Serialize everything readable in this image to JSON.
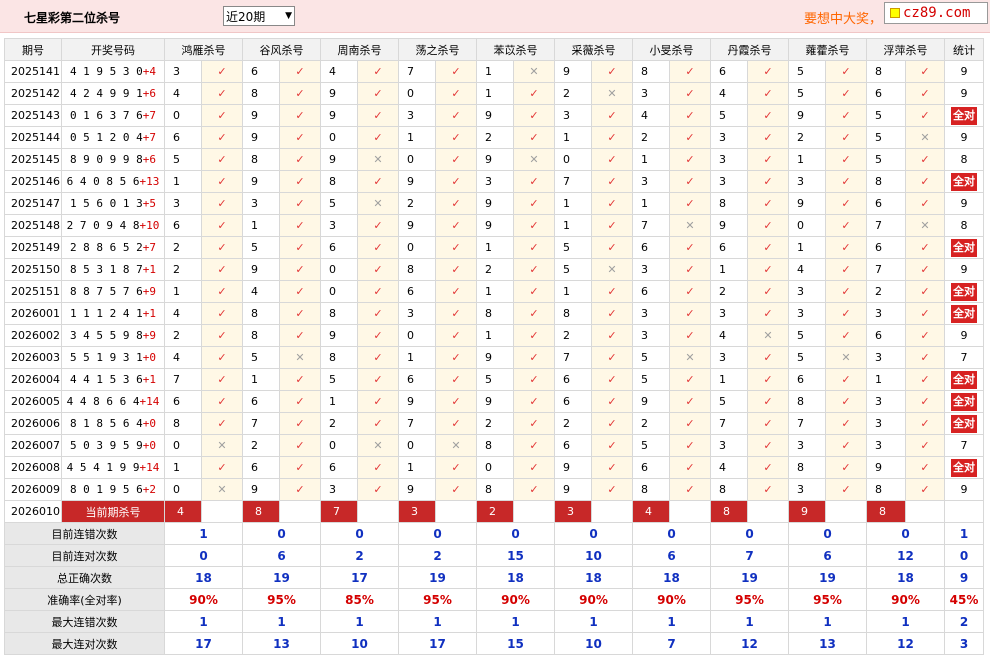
{
  "page": {
    "title": "七星彩第二位杀号",
    "period_select": "近20期",
    "promo": "要想中大奖，",
    "logo": "cz89.com"
  },
  "columns": {
    "issue": "期号",
    "draw": "开奖号码",
    "kills": [
      "鸿雁杀号",
      "谷风杀号",
      "周南杀号",
      "荡之杀号",
      "苯苡杀号",
      "采薇杀号",
      "小旻杀号",
      "丹霞杀号",
      "蕹藿杀号",
      "浮萍杀号"
    ],
    "total": "统计"
  },
  "rows": [
    {
      "issue": "2025141",
      "draw": "419530",
      "plus": "+4",
      "kills": [
        [
          3,
          1
        ],
        [
          6,
          1
        ],
        [
          4,
          1
        ],
        [
          7,
          1
        ],
        [
          1,
          0
        ],
        [
          9,
          1
        ],
        [
          8,
          1
        ],
        [
          6,
          1
        ],
        [
          5,
          1
        ],
        [
          8,
          1
        ]
      ],
      "total": "9"
    },
    {
      "issue": "2025142",
      "draw": "424991",
      "plus": "+6",
      "kills": [
        [
          4,
          1
        ],
        [
          8,
          1
        ],
        [
          9,
          1
        ],
        [
          0,
          1
        ],
        [
          1,
          1
        ],
        [
          2,
          0
        ],
        [
          3,
          1
        ],
        [
          4,
          1
        ],
        [
          5,
          1
        ],
        [
          6,
          1
        ]
      ],
      "total": "9"
    },
    {
      "issue": "2025143",
      "draw": "016376",
      "plus": "+7",
      "kills": [
        [
          0,
          1
        ],
        [
          9,
          1
        ],
        [
          9,
          1
        ],
        [
          3,
          1
        ],
        [
          9,
          1
        ],
        [
          3,
          1
        ],
        [
          4,
          1
        ],
        [
          5,
          1
        ],
        [
          9,
          1
        ],
        [
          5,
          1
        ]
      ],
      "total": "全对"
    },
    {
      "issue": "2025144",
      "draw": "051204",
      "plus": "+7",
      "kills": [
        [
          6,
          1
        ],
        [
          9,
          1
        ],
        [
          0,
          1
        ],
        [
          1,
          1
        ],
        [
          2,
          1
        ],
        [
          1,
          1
        ],
        [
          2,
          1
        ],
        [
          3,
          1
        ],
        [
          2,
          1
        ],
        [
          5,
          0
        ]
      ],
      "total": "9"
    },
    {
      "issue": "2025145",
      "draw": "890998",
      "plus": "+6",
      "kills": [
        [
          5,
          1
        ],
        [
          8,
          1
        ],
        [
          9,
          0
        ],
        [
          0,
          1
        ],
        [
          9,
          0
        ],
        [
          0,
          1
        ],
        [
          1,
          1
        ],
        [
          3,
          1
        ],
        [
          1,
          1
        ],
        [
          5,
          1
        ]
      ],
      "total": "8"
    },
    {
      "issue": "2025146",
      "draw": "640856",
      "plus": "+13",
      "kills": [
        [
          1,
          1
        ],
        [
          9,
          1
        ],
        [
          8,
          1
        ],
        [
          9,
          1
        ],
        [
          3,
          1
        ],
        [
          7,
          1
        ],
        [
          3,
          1
        ],
        [
          3,
          1
        ],
        [
          3,
          1
        ],
        [
          8,
          1
        ]
      ],
      "total": "全对"
    },
    {
      "issue": "2025147",
      "draw": "156013",
      "plus": "+5",
      "kills": [
        [
          3,
          1
        ],
        [
          3,
          1
        ],
        [
          5,
          0
        ],
        [
          2,
          1
        ],
        [
          9,
          1
        ],
        [
          1,
          1
        ],
        [
          1,
          1
        ],
        [
          8,
          1
        ],
        [
          9,
          1
        ],
        [
          6,
          1
        ]
      ],
      "total": "9"
    },
    {
      "issue": "2025148",
      "draw": "270948",
      "plus": "+10",
      "kills": [
        [
          6,
          1
        ],
        [
          1,
          1
        ],
        [
          3,
          1
        ],
        [
          9,
          1
        ],
        [
          9,
          1
        ],
        [
          1,
          1
        ],
        [
          7,
          0
        ],
        [
          9,
          1
        ],
        [
          0,
          1
        ],
        [
          7,
          0
        ]
      ],
      "total": "8"
    },
    {
      "issue": "2025149",
      "draw": "288652",
      "plus": "+7",
      "kills": [
        [
          2,
          1
        ],
        [
          5,
          1
        ],
        [
          6,
          1
        ],
        [
          0,
          1
        ],
        [
          1,
          1
        ],
        [
          5,
          1
        ],
        [
          6,
          1
        ],
        [
          6,
          1
        ],
        [
          1,
          1
        ],
        [
          6,
          1
        ]
      ],
      "total": "全对"
    },
    {
      "issue": "2025150",
      "draw": "853187",
      "plus": "+1",
      "kills": [
        [
          2,
          1
        ],
        [
          9,
          1
        ],
        [
          0,
          1
        ],
        [
          8,
          1
        ],
        [
          2,
          1
        ],
        [
          5,
          0
        ],
        [
          3,
          1
        ],
        [
          1,
          1
        ],
        [
          4,
          1
        ],
        [
          7,
          1
        ]
      ],
      "total": "9"
    },
    {
      "issue": "2025151",
      "draw": "887576",
      "plus": "+9",
      "kills": [
        [
          1,
          1
        ],
        [
          4,
          1
        ],
        [
          0,
          1
        ],
        [
          6,
          1
        ],
        [
          1,
          1
        ],
        [
          1,
          1
        ],
        [
          6,
          1
        ],
        [
          2,
          1
        ],
        [
          3,
          1
        ],
        [
          2,
          1
        ]
      ],
      "total": "全对"
    },
    {
      "issue": "2026001",
      "draw": "111241",
      "plus": "+1",
      "kills": [
        [
          4,
          1
        ],
        [
          8,
          1
        ],
        [
          8,
          1
        ],
        [
          3,
          1
        ],
        [
          8,
          1
        ],
        [
          8,
          1
        ],
        [
          3,
          1
        ],
        [
          3,
          1
        ],
        [
          3,
          1
        ],
        [
          3,
          1
        ]
      ],
      "total": "全对"
    },
    {
      "issue": "2026002",
      "draw": "345598",
      "plus": "+9",
      "kills": [
        [
          2,
          1
        ],
        [
          8,
          1
        ],
        [
          9,
          1
        ],
        [
          0,
          1
        ],
        [
          1,
          1
        ],
        [
          2,
          1
        ],
        [
          3,
          1
        ],
        [
          4,
          0
        ],
        [
          5,
          1
        ],
        [
          6,
          1
        ]
      ],
      "total": "9"
    },
    {
      "issue": "2026003",
      "draw": "551931",
      "plus": "+0",
      "kills": [
        [
          4,
          1
        ],
        [
          5,
          0
        ],
        [
          8,
          1
        ],
        [
          1,
          1
        ],
        [
          9,
          1
        ],
        [
          7,
          1
        ],
        [
          5,
          0
        ],
        [
          3,
          1
        ],
        [
          5,
          0
        ],
        [
          3,
          1
        ]
      ],
      "total": "7"
    },
    {
      "issue": "2026004",
      "draw": "441536",
      "plus": "+1",
      "kills": [
        [
          7,
          1
        ],
        [
          1,
          1
        ],
        [
          5,
          1
        ],
        [
          6,
          1
        ],
        [
          5,
          1
        ],
        [
          6,
          1
        ],
        [
          5,
          1
        ],
        [
          1,
          1
        ],
        [
          6,
          1
        ],
        [
          1,
          1
        ]
      ],
      "total": "全对"
    },
    {
      "issue": "2026005",
      "draw": "448664",
      "plus": "+14",
      "kills": [
        [
          6,
          1
        ],
        [
          6,
          1
        ],
        [
          1,
          1
        ],
        [
          9,
          1
        ],
        [
          9,
          1
        ],
        [
          6,
          1
        ],
        [
          9,
          1
        ],
        [
          5,
          1
        ],
        [
          8,
          1
        ],
        [
          3,
          1
        ]
      ],
      "total": "全对"
    },
    {
      "issue": "2026006",
      "draw": "818564",
      "plus": "+0",
      "kills": [
        [
          8,
          1
        ],
        [
          7,
          1
        ],
        [
          2,
          1
        ],
        [
          7,
          1
        ],
        [
          2,
          1
        ],
        [
          2,
          1
        ],
        [
          2,
          1
        ],
        [
          7,
          1
        ],
        [
          7,
          1
        ],
        [
          3,
          1
        ]
      ],
      "total": "全对"
    },
    {
      "issue": "2026007",
      "draw": "503959",
      "plus": "+0",
      "kills": [
        [
          0,
          0
        ],
        [
          2,
          1
        ],
        [
          0,
          0
        ],
        [
          0,
          0
        ],
        [
          8,
          1
        ],
        [
          6,
          1
        ],
        [
          5,
          1
        ],
        [
          3,
          1
        ],
        [
          3,
          1
        ],
        [
          3,
          1
        ]
      ],
      "total": "7"
    },
    {
      "issue": "2026008",
      "draw": "454199",
      "plus": "+14",
      "kills": [
        [
          1,
          1
        ],
        [
          6,
          1
        ],
        [
          6,
          1
        ],
        [
          1,
          1
        ],
        [
          0,
          1
        ],
        [
          9,
          1
        ],
        [
          6,
          1
        ],
        [
          4,
          1
        ],
        [
          8,
          1
        ],
        [
          9,
          1
        ]
      ],
      "total": "全对"
    },
    {
      "issue": "2026009",
      "draw": "801956",
      "plus": "+2",
      "kills": [
        [
          0,
          0
        ],
        [
          9,
          1
        ],
        [
          3,
          1
        ],
        [
          9,
          1
        ],
        [
          8,
          1
        ],
        [
          9,
          1
        ],
        [
          8,
          1
        ],
        [
          8,
          1
        ],
        [
          3,
          1
        ],
        [
          8,
          1
        ]
      ],
      "total": "9"
    }
  ],
  "current": {
    "issue": "2026010",
    "label": "当前期杀号",
    "kills": [
      "4",
      "8",
      "7",
      "3",
      "2",
      "3",
      "4",
      "8",
      "9",
      "8"
    ]
  },
  "stats": [
    {
      "label": "目前连错次数",
      "values": [
        "1",
        "0",
        "0",
        "0",
        "0",
        "0",
        "0",
        "0",
        "0",
        "0",
        "1"
      ]
    },
    {
      "label": "目前连对次数",
      "values": [
        "0",
        "6",
        "2",
        "2",
        "15",
        "10",
        "6",
        "7",
        "6",
        "12",
        "0"
      ]
    },
    {
      "label": "总正确次数",
      "values": [
        "18",
        "19",
        "17",
        "19",
        "18",
        "18",
        "18",
        "19",
        "19",
        "18",
        "9"
      ]
    },
    {
      "label": "准确率(全对率)",
      "values": [
        "90%",
        "95%",
        "85%",
        "95%",
        "90%",
        "90%",
        "90%",
        "95%",
        "95%",
        "90%",
        "45%"
      ],
      "rate": true
    },
    {
      "label": "最大连错次数",
      "values": [
        "1",
        "1",
        "1",
        "1",
        "1",
        "1",
        "1",
        "1",
        "1",
        "1",
        "2"
      ]
    },
    {
      "label": "最大连对次数",
      "values": [
        "17",
        "13",
        "10",
        "17",
        "15",
        "10",
        "7",
        "12",
        "13",
        "12",
        "3"
      ]
    }
  ],
  "marks": {
    "right": "✓",
    "wrong": "✕"
  },
  "colors": {
    "accent_red": "#d72222",
    "header_bg": "#fbe5e5",
    "stat_blue": "#1030c0",
    "promo": "#ff6600"
  }
}
